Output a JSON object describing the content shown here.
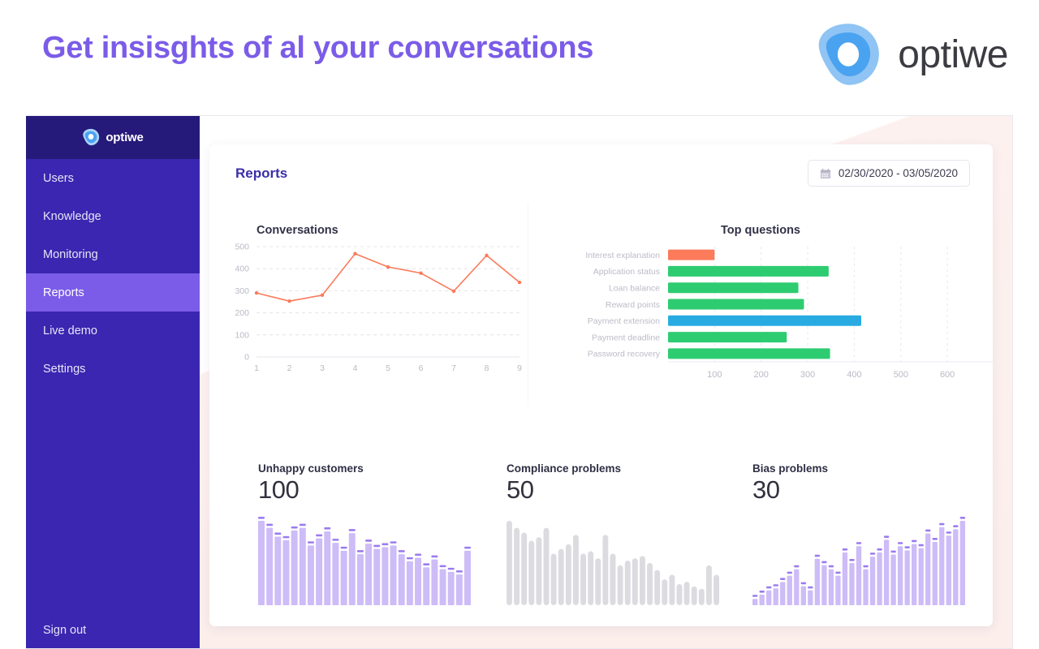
{
  "promo": {
    "headline": "Get insisghts of al your conversations",
    "brand_word": "optiwe",
    "logo_icon": "optiwe-blob-logo",
    "headline_color": "#7B5CE8"
  },
  "sidebar": {
    "brand": "optiwe",
    "logo_icon": "optiwe-blob-logo",
    "bg_color": "#3A26B0",
    "header_color": "#251A7A",
    "active_color": "#7B5CE8",
    "items": [
      {
        "label": "Users",
        "active": false
      },
      {
        "label": "Knowledge",
        "active": false
      },
      {
        "label": "Monitoring",
        "active": false
      },
      {
        "label": "Reports",
        "active": true
      },
      {
        "label": "Live demo",
        "active": false
      },
      {
        "label": "Settings",
        "active": false
      }
    ],
    "signout": "Sign out"
  },
  "header": {
    "title": "Reports",
    "title_color": "#3b2ea8",
    "daterange": "02/30/2020 - 03/05/2020",
    "daterange_icon": "calendar-icon"
  },
  "chart_data": [
    {
      "type": "line",
      "title": "Conversations",
      "xlabel": "",
      "ylabel": "",
      "x": [
        1,
        2,
        3,
        4,
        5,
        6,
        7,
        8,
        9
      ],
      "values": [
        290,
        253,
        280,
        468,
        408,
        380,
        298,
        460,
        338
      ],
      "xtick_labels": [
        "1",
        "2",
        "3",
        "4",
        "5",
        "6",
        "7",
        "8",
        "9"
      ],
      "ytick_labels": [
        "0",
        "100",
        "200",
        "300",
        "400",
        "500"
      ],
      "ylim": [
        0,
        500
      ],
      "grid": true,
      "legend": "none",
      "series_color": "#FB7B5B"
    },
    {
      "type": "bar",
      "orientation": "horizontal",
      "title": "Top questions",
      "categories": [
        "Interest explanation",
        "Application status",
        "Loan balance",
        "Reward points",
        "Payment extension",
        "Payment deadline",
        "Password recovery"
      ],
      "values": [
        100,
        345,
        280,
        292,
        415,
        255,
        348
      ],
      "bar_colors": [
        "#FB7B5B",
        "#2ECC71",
        "#2ECC71",
        "#2ECC71",
        "#29ABE2",
        "#2ECC71",
        "#2ECC71"
      ],
      "xtick_labels": [
        "100",
        "200",
        "300",
        "400",
        "500",
        "600"
      ],
      "xlim": [
        0,
        680
      ],
      "grid": true,
      "legend": "none"
    },
    {
      "type": "bar",
      "title": "Unhappy customers",
      "metric_value": "100",
      "bar_color": "#CDBCF7",
      "cap_color": "#9B7BEF",
      "values": [
        96,
        88,
        78,
        74,
        85,
        88,
        68,
        76,
        84,
        71,
        62,
        82,
        58,
        70,
        64,
        66,
        68,
        58,
        50,
        54,
        43,
        52,
        41,
        38,
        35,
        62
      ]
    },
    {
      "type": "bar",
      "title": "Compliance problems",
      "metric_value": "50",
      "bar_color": "#DCDCE0",
      "values": [
        72,
        66,
        62,
        55,
        58,
        66,
        44,
        48,
        52,
        60,
        44,
        46,
        40,
        60,
        44,
        34,
        38,
        40,
        42,
        36,
        30,
        22,
        26,
        18,
        20,
        16,
        14,
        34,
        26
      ]
    },
    {
      "type": "bar",
      "title": "Bias problems",
      "metric_value": "30",
      "bar_color": "#CDBCF7",
      "cap_color": "#9B7BEF",
      "values": [
        6,
        10,
        14,
        16,
        22,
        28,
        34,
        18,
        14,
        44,
        38,
        34,
        28,
        50,
        40,
        56,
        34,
        46,
        50,
        62,
        48,
        56,
        52,
        58,
        54,
        68,
        60,
        74,
        66,
        72,
        80
      ]
    }
  ],
  "metrics": [
    {
      "label": "Unhappy customers",
      "value": "100"
    },
    {
      "label": "Compliance problems",
      "value": "50"
    },
    {
      "label": "Bias problems",
      "value": "30"
    }
  ]
}
